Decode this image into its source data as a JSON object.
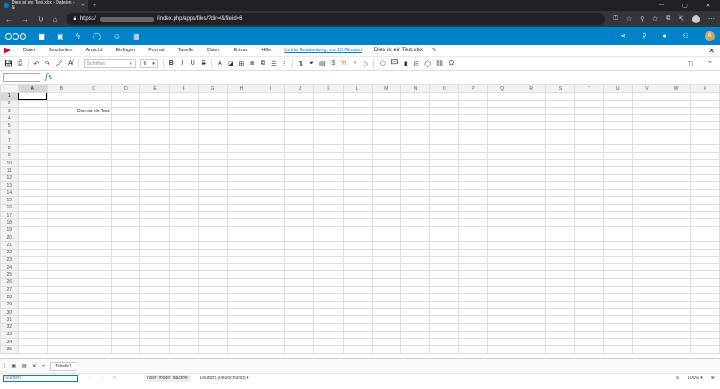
{
  "browser": {
    "tab_title": "Dies ist ein Test.xlsx - Dateien - N",
    "url_prefix": "https://",
    "url_suffix": "/index.php/apps/files/?dir=/&fileid=6",
    "avatar_letter": "A"
  },
  "nextcloud": {
    "apps": [
      "files-icon",
      "photos-icon",
      "activity-icon",
      "talk-icon",
      "contacts-icon",
      "calendar-icon"
    ],
    "avatar_letter": "A",
    "brand_color": "#0082c9"
  },
  "menubar": {
    "items": [
      "Datei",
      "Bearbeiten",
      "Ansicht",
      "Einfügen",
      "Format",
      "Tabelle",
      "Daten",
      "Extras",
      "Hilfe"
    ],
    "last_edit": "Letzte Bearbeitung, vor 15 Minuten",
    "document_name": "Dies ist ein Test.xlsx"
  },
  "toolbar": {
    "font_name_placeholder": "Schriftart",
    "font_size": "6"
  },
  "formula_bar": {
    "name_box": "",
    "fx_label": "fx"
  },
  "sheet": {
    "columns": [
      "A",
      "B",
      "C",
      "D",
      "E",
      "F",
      "G",
      "H",
      "I",
      "J",
      "K",
      "L",
      "M",
      "N",
      "O",
      "P",
      "Q",
      "R",
      "S",
      "T",
      "U",
      "V",
      "W",
      "X"
    ],
    "row_count": 35,
    "active_column": "A",
    "active_row": 1,
    "cells": [
      {
        "row": 3,
        "col": "C",
        "value": "Dies ist ein Test."
      }
    ]
  },
  "sheet_tabs": [
    "Tabelle1"
  ],
  "statusbar": {
    "search_placeholder": "Suchen",
    "insert_mode": "Insert mode: inactive",
    "language": "Deutsch (Deutschland)",
    "zoom": "100%"
  }
}
